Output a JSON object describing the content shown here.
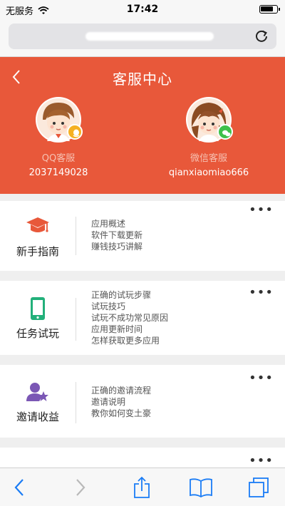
{
  "status_bar": {
    "carrier": "无服务",
    "time": "17:42"
  },
  "header": {
    "title": "客服中心"
  },
  "services": [
    {
      "name": "QQ客服",
      "id": "2037149028"
    },
    {
      "name": "微信客服",
      "id": "qianxiaomiao666"
    }
  ],
  "cards": [
    {
      "title": "新手指南",
      "icon": "graduation-cap-icon",
      "links": [
        "应用概述",
        "软件下载更新",
        "赚钱技巧讲解"
      ]
    },
    {
      "title": "任务试玩",
      "icon": "phone-icon",
      "links": [
        "正确的试玩步骤",
        "试玩技巧",
        "试玩不成功常见原因",
        "应用更新时间",
        "怎样获取更多应用"
      ]
    },
    {
      "title": "邀请收益",
      "icon": "user-star-icon",
      "links": [
        "正确的邀请流程",
        "邀请说明",
        "教你如何变土豪"
      ]
    }
  ],
  "more_label": "•••",
  "colors": {
    "header_bg": "#e8583a",
    "service_name": "#f6c1b2",
    "toolbar_icon": "#1a7cf5",
    "guide_icon": "#e8583a",
    "trial_icon": "#22b07a",
    "invite_icon": "#7b57b5"
  }
}
